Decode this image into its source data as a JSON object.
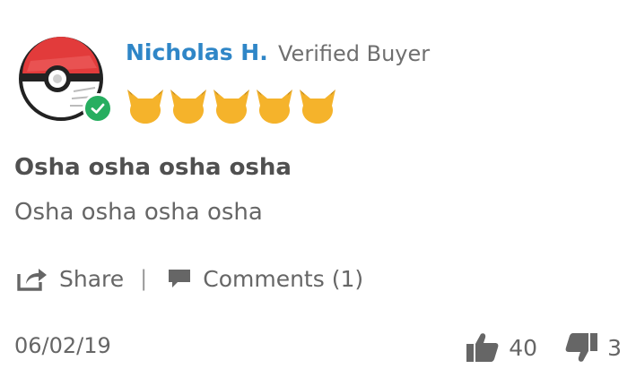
{
  "review": {
    "reviewer_name": "Nicholas H.",
    "reviewer_status": "Verified Buyer",
    "rating": 5,
    "rating_max": 5,
    "rating_icon": "pikachu-face-icon",
    "title": "Osha osha osha osha",
    "body": "Osha osha osha osha",
    "date": "06/02/19",
    "share_label": "Share",
    "separator": "|",
    "comments_label": "Comments (1)",
    "upvotes": "40",
    "downvotes": "3"
  },
  "colors": {
    "name": "#2f86c7",
    "star": "#f5b32b",
    "verified": "#27ae60",
    "avatar_red": "#e23b3b",
    "text": "#666666"
  }
}
